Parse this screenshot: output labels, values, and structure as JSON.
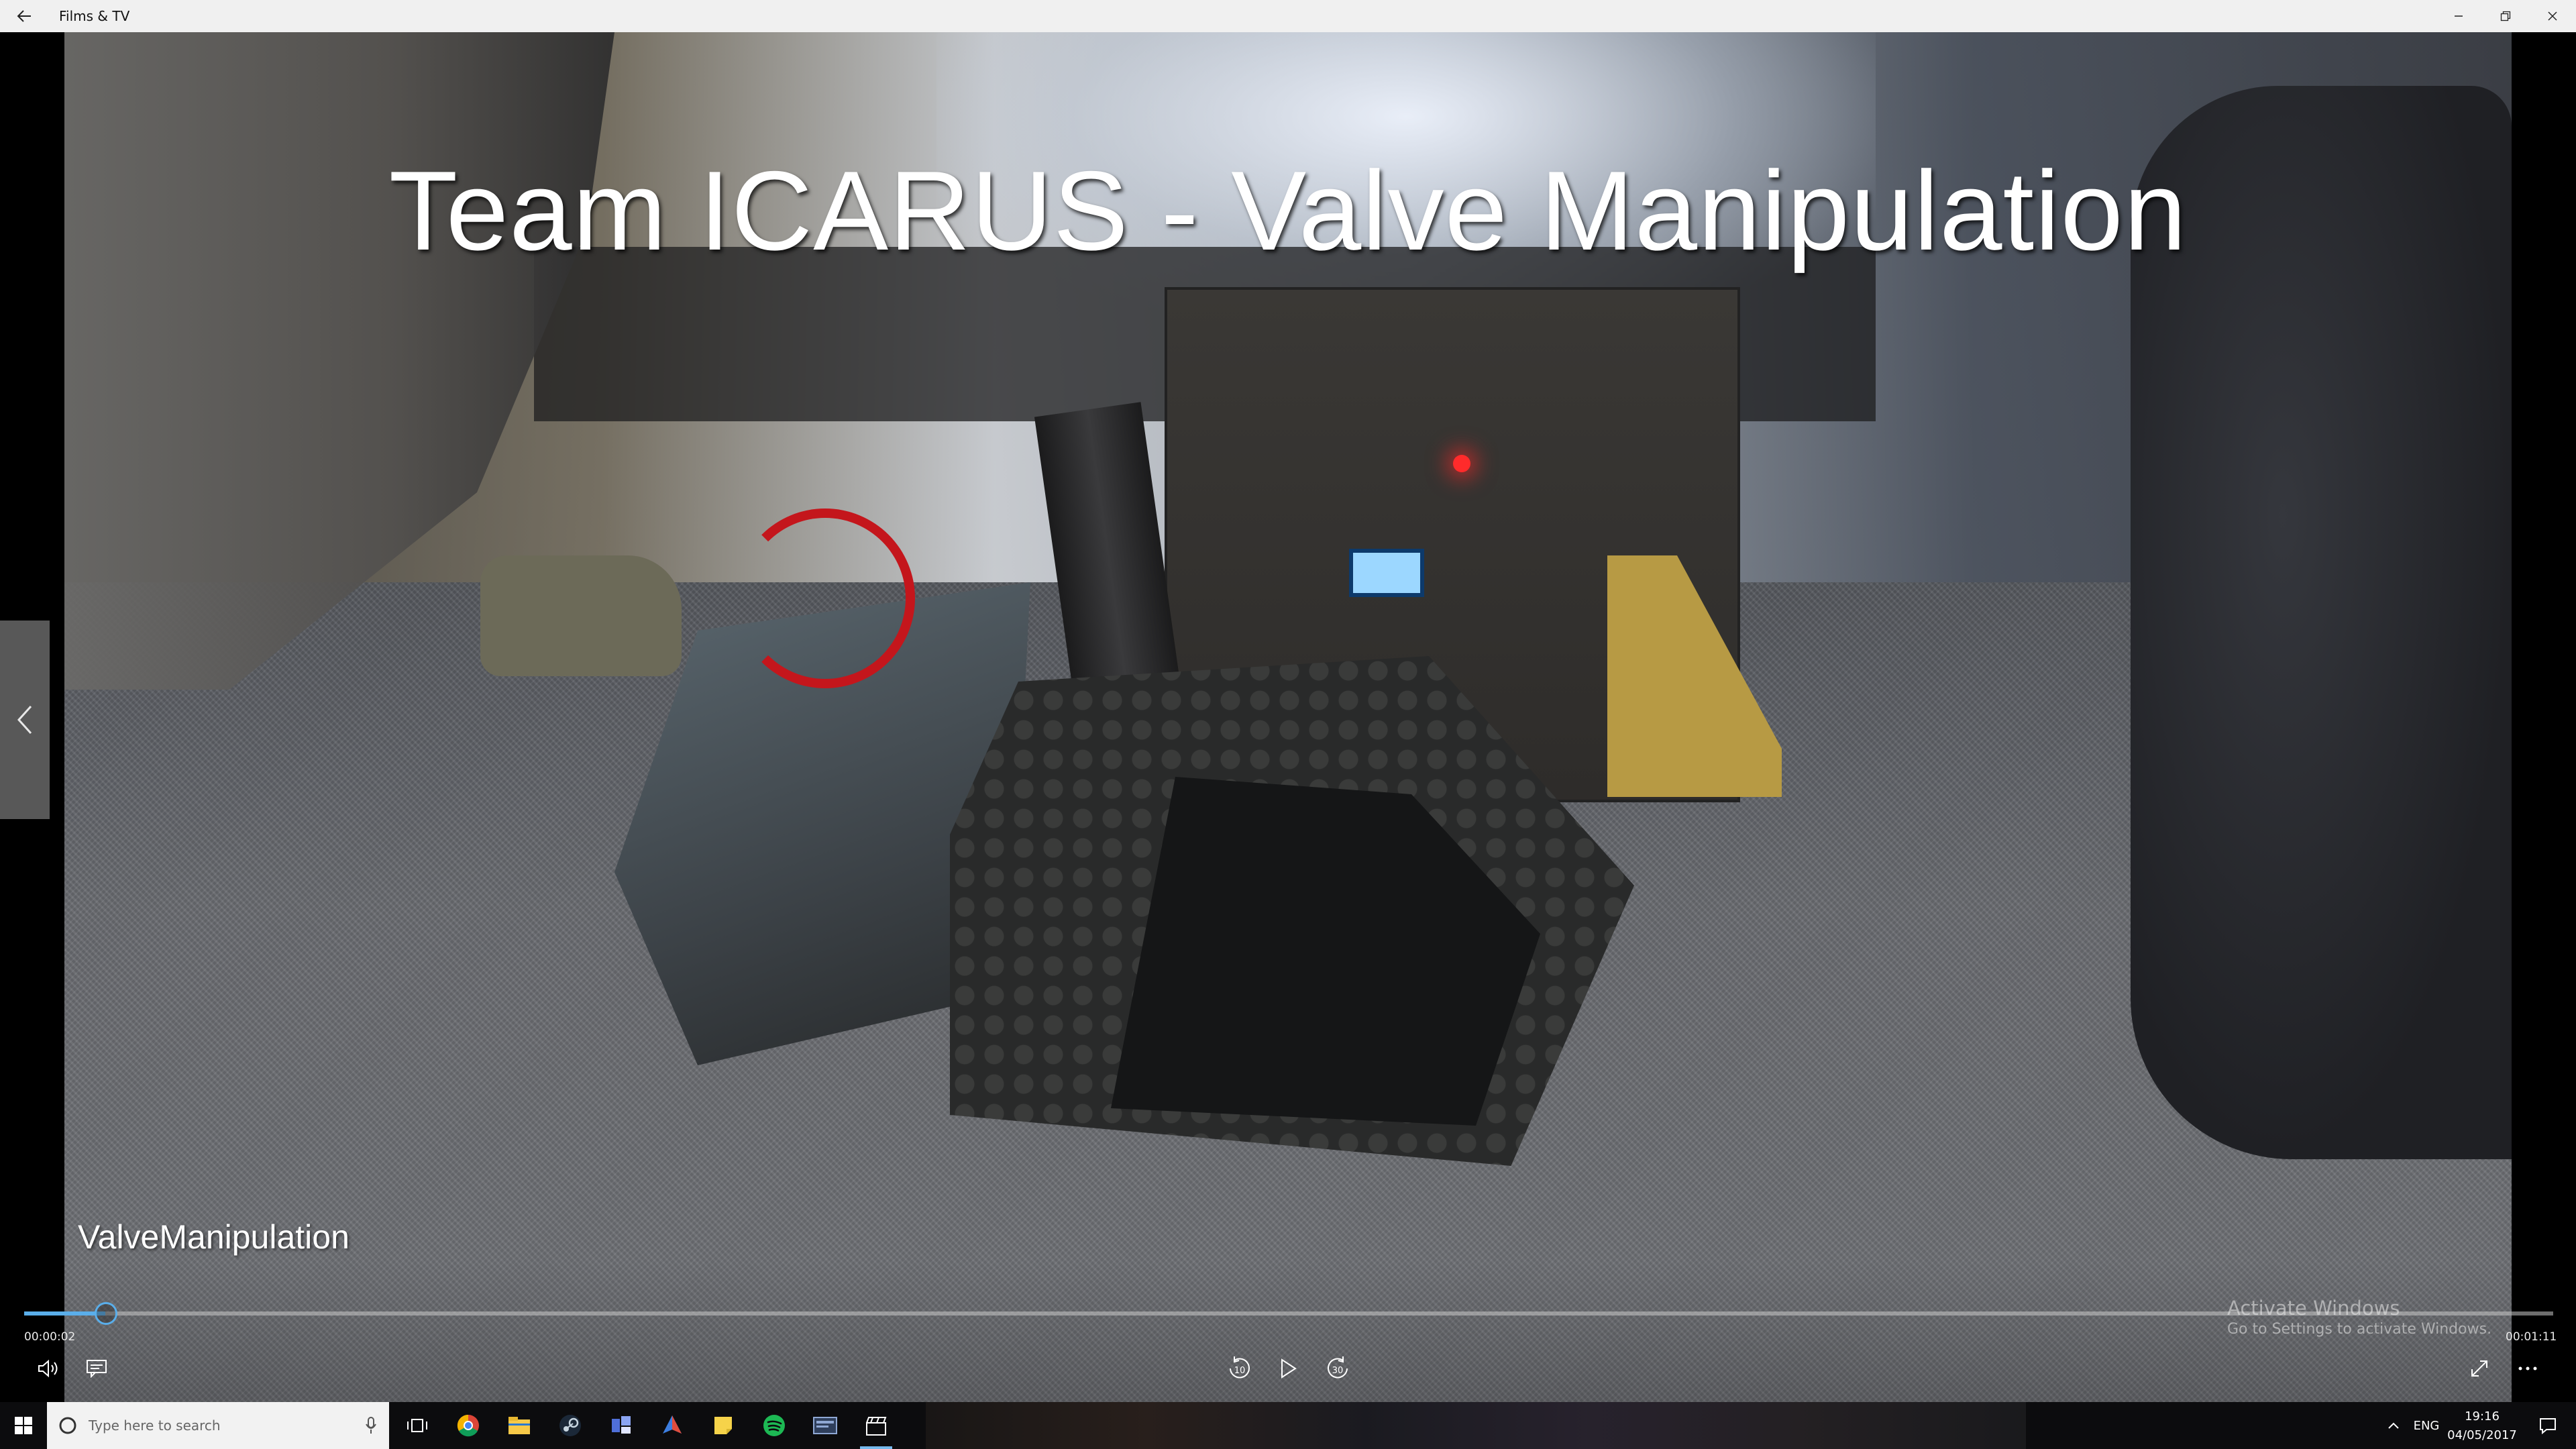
{
  "window": {
    "title": "Films & TV",
    "back_icon": "back-arrow-icon",
    "buttons": [
      "minimize-icon",
      "restore-icon",
      "close-icon"
    ]
  },
  "video": {
    "overlay_title": "Team ICARUS - Valve Manipulation",
    "file_name": "ValveManipulation"
  },
  "player": {
    "current_time": "00:00:02",
    "total_time": "00:01:11",
    "progress": 0.032,
    "skip_back_label": "10",
    "skip_forward_label": "30",
    "accent_color": "#5aaeea"
  },
  "watermark": {
    "line1": "Activate Windows",
    "line2": "Go to Settings to activate Windows."
  },
  "taskbar": {
    "search_placeholder": "Type here to search",
    "apps": [
      "chrome-icon",
      "file-explorer-icon",
      "steam-icon",
      "app-icon",
      "app-icon",
      "sticky-notes-icon",
      "spotify-icon",
      "app-icon",
      "films-tv-icon"
    ],
    "language": "ENG",
    "time": "19:16",
    "date": "04/05/2017"
  }
}
